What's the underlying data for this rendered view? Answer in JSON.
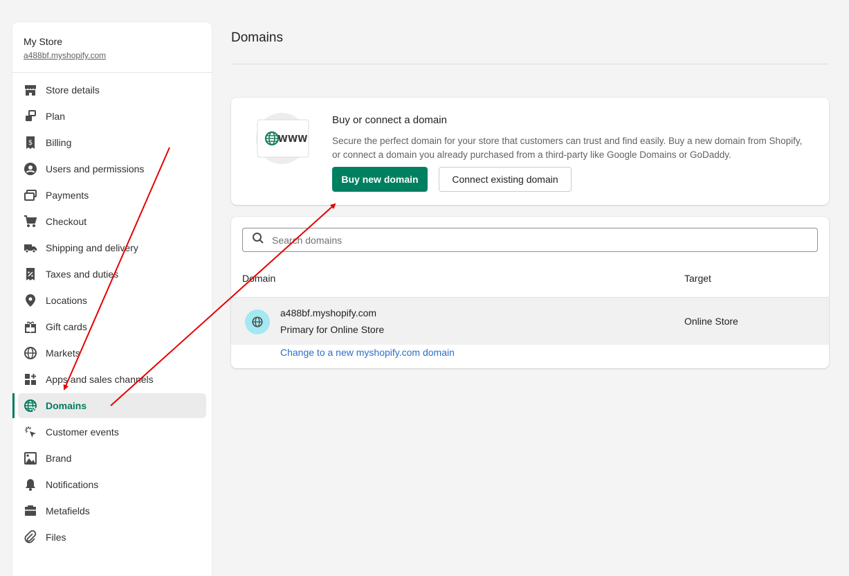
{
  "store": {
    "name": "My Store",
    "url": "a488bf.myshopify.com"
  },
  "nav": [
    {
      "label": "Store details",
      "icon": "store-icon"
    },
    {
      "label": "Plan",
      "icon": "plan-icon"
    },
    {
      "label": "Billing",
      "icon": "billing-icon"
    },
    {
      "label": "Users and permissions",
      "icon": "user-icon"
    },
    {
      "label": "Payments",
      "icon": "payments-icon"
    },
    {
      "label": "Checkout",
      "icon": "cart-icon"
    },
    {
      "label": "Shipping and delivery",
      "icon": "truck-icon"
    },
    {
      "label": "Taxes and duties",
      "icon": "tax-icon"
    },
    {
      "label": "Locations",
      "icon": "location-pin-icon"
    },
    {
      "label": "Gift cards",
      "icon": "gift-icon"
    },
    {
      "label": "Markets",
      "icon": "globe-icon"
    },
    {
      "label": "Apps and sales channels",
      "icon": "apps-icon"
    },
    {
      "label": "Domains",
      "icon": "domains-globe-icon",
      "active": true
    },
    {
      "label": "Customer events",
      "icon": "cursor-click-icon"
    },
    {
      "label": "Brand",
      "icon": "brand-image-icon"
    },
    {
      "label": "Notifications",
      "icon": "bell-icon"
    },
    {
      "label": "Metafields",
      "icon": "metafields-icon"
    },
    {
      "label": "Files",
      "icon": "paperclip-icon"
    }
  ],
  "page": {
    "title": "Domains"
  },
  "promo": {
    "illustration_text": "WWW",
    "title": "Buy or connect a domain",
    "description": "Secure the perfect domain for your store that customers can trust and find easily. Buy a new domain from Shopify, or connect a domain you already purchased from a third-party like Google Domains or GoDaddy.",
    "buy_label": "Buy new domain",
    "connect_label": "Connect existing domain"
  },
  "domains": {
    "search_placeholder": "Search domains",
    "columns": {
      "domain": "Domain",
      "target": "Target"
    },
    "rows": [
      {
        "domain": "a488bf.myshopify.com",
        "subtitle": "Primary for Online Store",
        "target": "Online Store"
      }
    ],
    "change_link": "Change to a new myshopify.com domain"
  },
  "colors": {
    "accent": "#008060",
    "active_nav": "#007a5c",
    "link": "#2c6ecb",
    "annotation": "#e50000",
    "globe_badge": "#a4e8f2"
  }
}
